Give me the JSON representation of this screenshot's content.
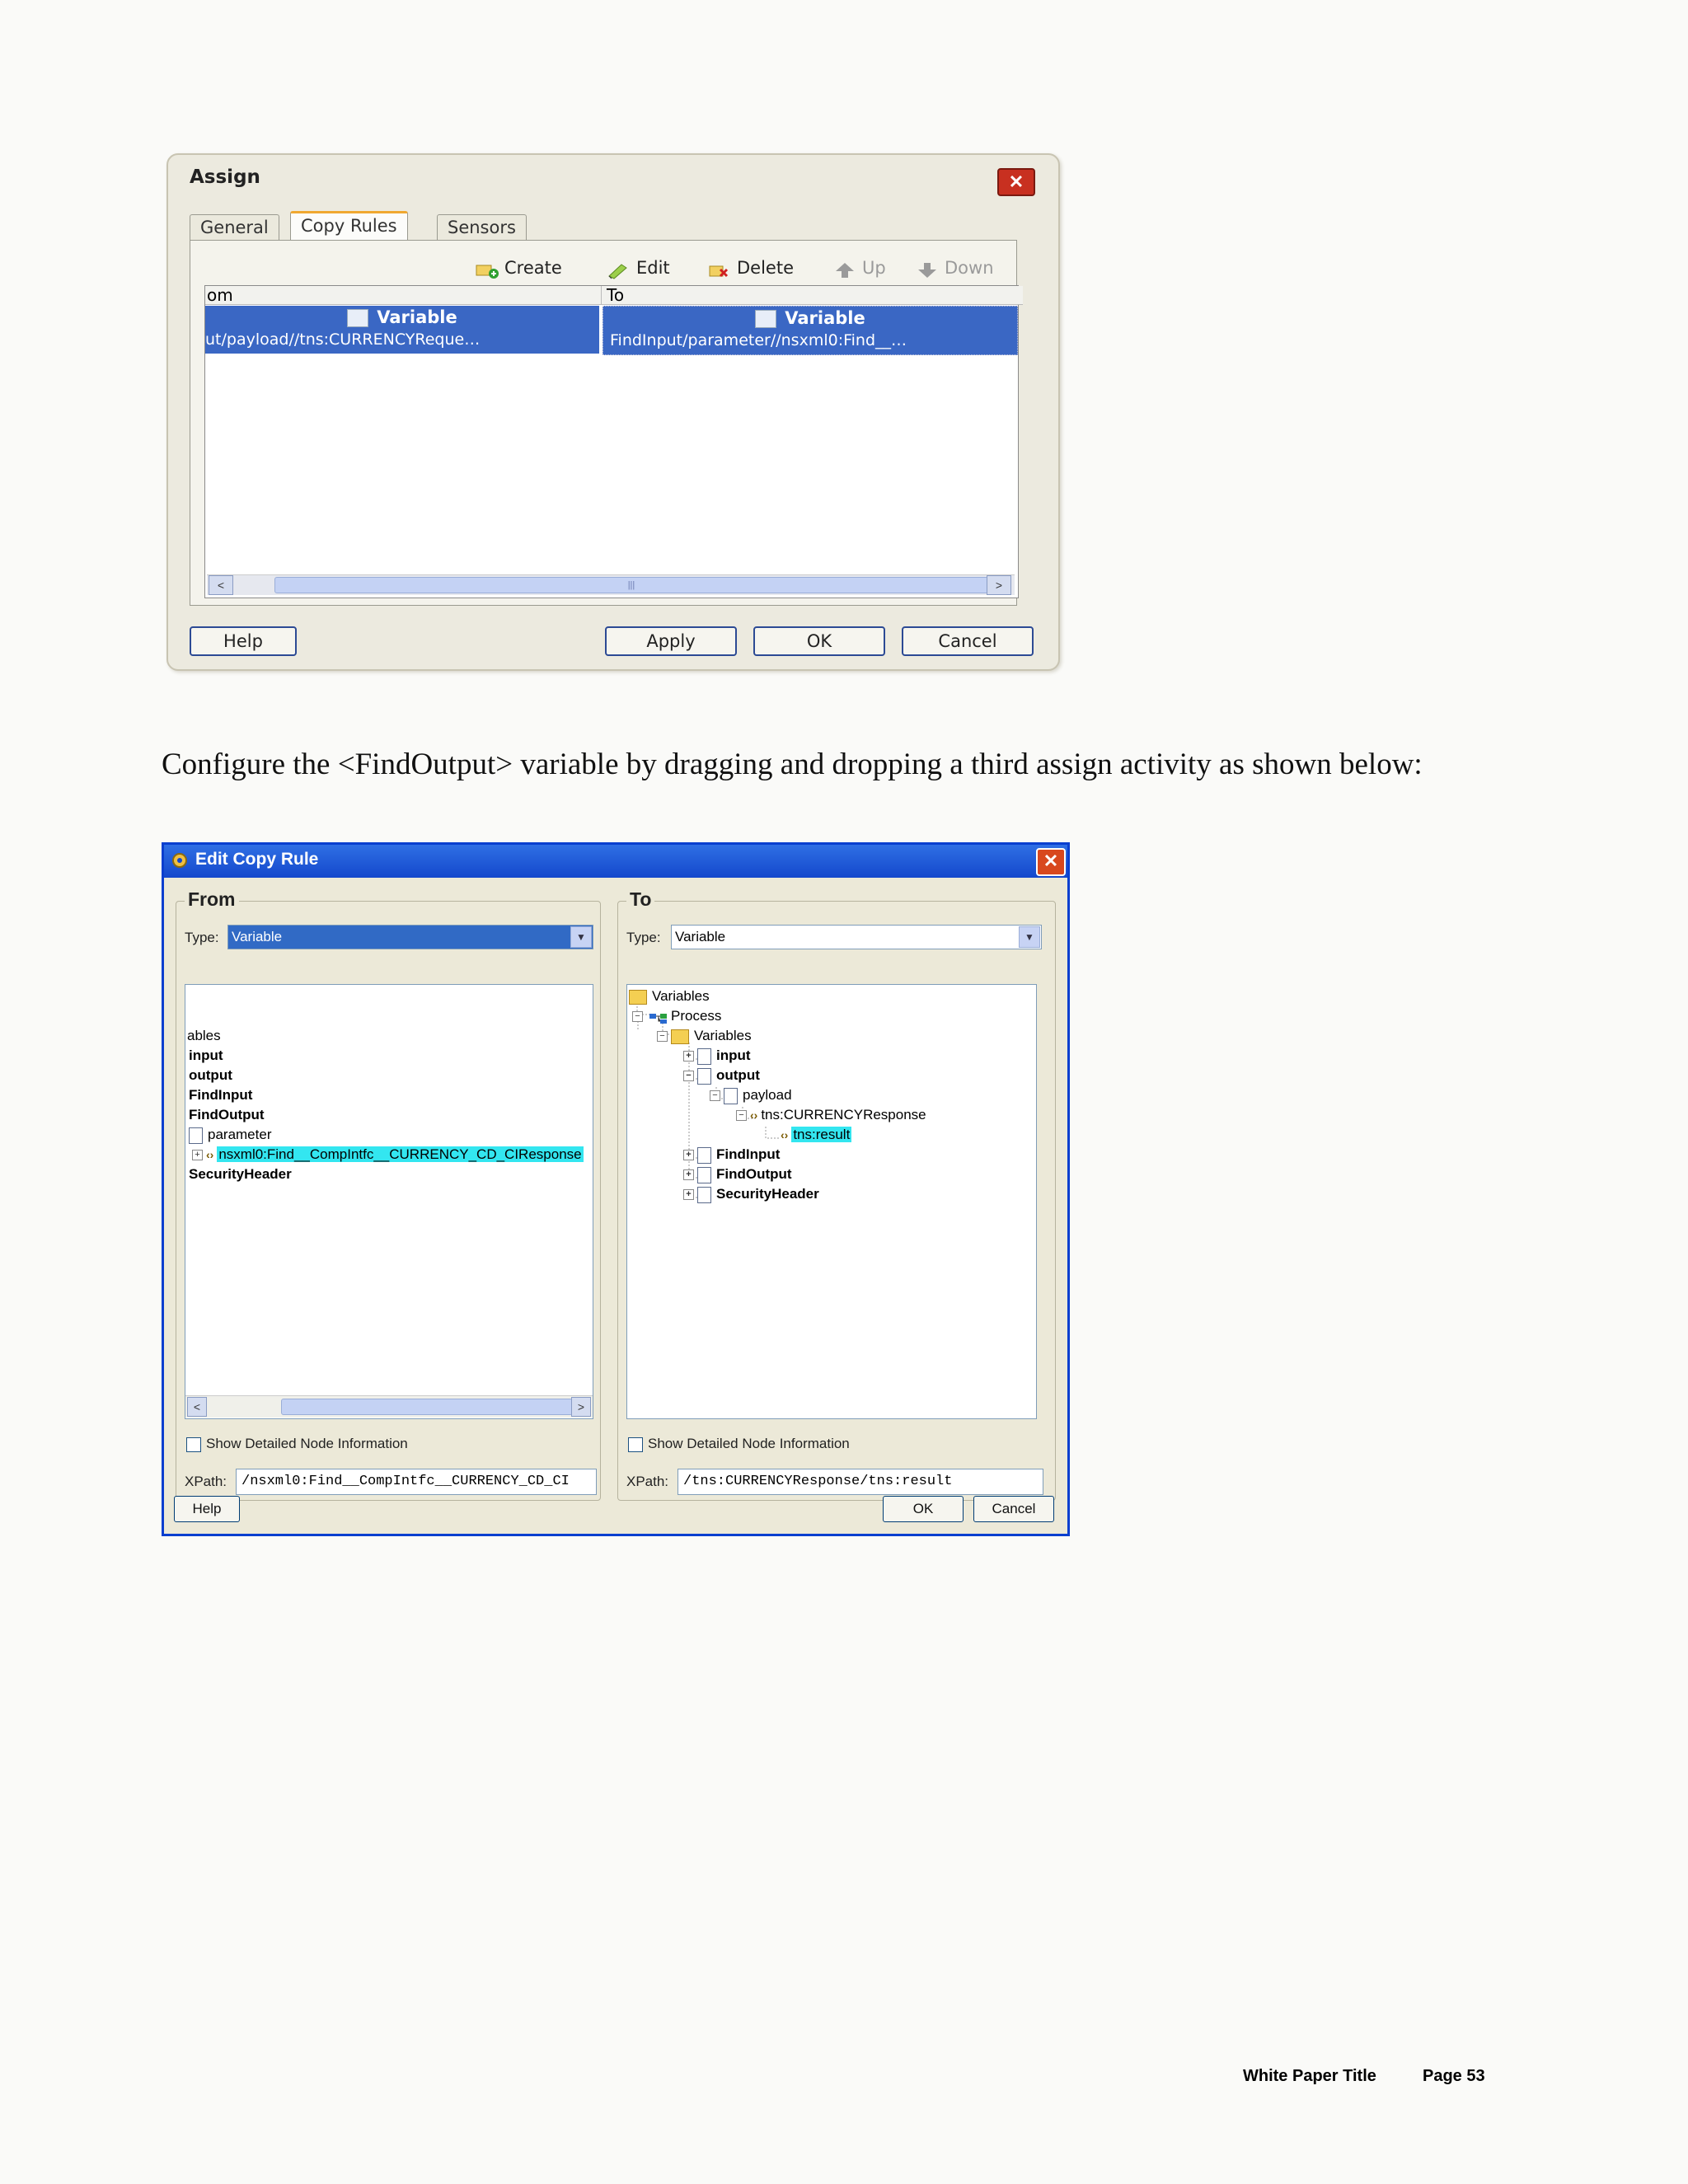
{
  "assign_dialog": {
    "title": "Assign",
    "close_glyph": "✕",
    "tabs": [
      "General",
      "Copy Rules",
      "Sensors"
    ],
    "active_tab": "Copy Rules",
    "toolbar": {
      "create": "Create",
      "edit": "Edit",
      "delete": "Delete",
      "up": "Up",
      "down": "Down"
    },
    "grid": {
      "col_from": "om",
      "col_to": "To",
      "row": {
        "from_kind": "Variable",
        "from_path": "ut/payload//tns:CURRENCYReque…",
        "to_kind": "Variable",
        "to_path": "FindInput/parameter//nsxml0:Find__…"
      },
      "scroll_left": "<",
      "scroll_right": ">",
      "scroll_grip": "|||"
    },
    "buttons": {
      "help": "Help",
      "apply": "Apply",
      "ok": "OK",
      "cancel": "Cancel"
    }
  },
  "caption": "Configure the <FindOutput> variable by dragging and dropping a third assign activity as shown below:",
  "edit_copy_rule": {
    "title": "Edit Copy Rule",
    "close_glyph": "✕",
    "from": {
      "group_label": "From",
      "type_label": "Type:",
      "type_value": "Variable",
      "tree": [
        {
          "text": "ables",
          "bold": false
        },
        {
          "text": "input",
          "bold": true
        },
        {
          "text": "output",
          "bold": true
        },
        {
          "text": "FindInput",
          "bold": true
        },
        {
          "text": "FindOutput",
          "bold": true
        },
        {
          "text": "parameter",
          "bold": false
        },
        {
          "text": "nsxml0:Find__CompIntfc__CURRENCY_CD_CIResponse",
          "bold": false
        },
        {
          "text": "SecurityHeader",
          "bold": true
        }
      ],
      "show_detail": "Show Detailed Node Information",
      "xpath_label": "XPath:",
      "xpath_value": "/nsxml0:Find__CompIntfc__CURRENCY_CD_CI"
    },
    "to": {
      "group_label": "To",
      "type_label": "Type:",
      "type_value": "Variable",
      "tree": [
        {
          "text": "Variables",
          "bold": false
        },
        {
          "text": "Process",
          "bold": false
        },
        {
          "text": "Variables",
          "bold": false
        },
        {
          "text": "input",
          "bold": true
        },
        {
          "text": "output",
          "bold": true
        },
        {
          "text": "payload",
          "bold": false
        },
        {
          "text": "tns:CURRENCYResponse",
          "bold": false
        },
        {
          "text": "tns:result",
          "bold": false
        },
        {
          "text": "FindInput",
          "bold": true
        },
        {
          "text": "FindOutput",
          "bold": true
        },
        {
          "text": "SecurityHeader",
          "bold": true
        }
      ],
      "show_detail": "Show Detailed Node Information",
      "xpath_label": "XPath:",
      "xpath_value": "/tns:CURRENCYResponse/tns:result"
    },
    "buttons": {
      "help": "Help",
      "ok": "OK",
      "cancel": "Cancel"
    }
  },
  "footer": {
    "title": "White Paper Title",
    "page": "Page 53"
  },
  "colors": {
    "selection_blue": "#3a67c4",
    "highlight_cyan": "#33e6f0",
    "xp_title_blue": "#1448cc",
    "dialog_face": "#ece9d8"
  }
}
